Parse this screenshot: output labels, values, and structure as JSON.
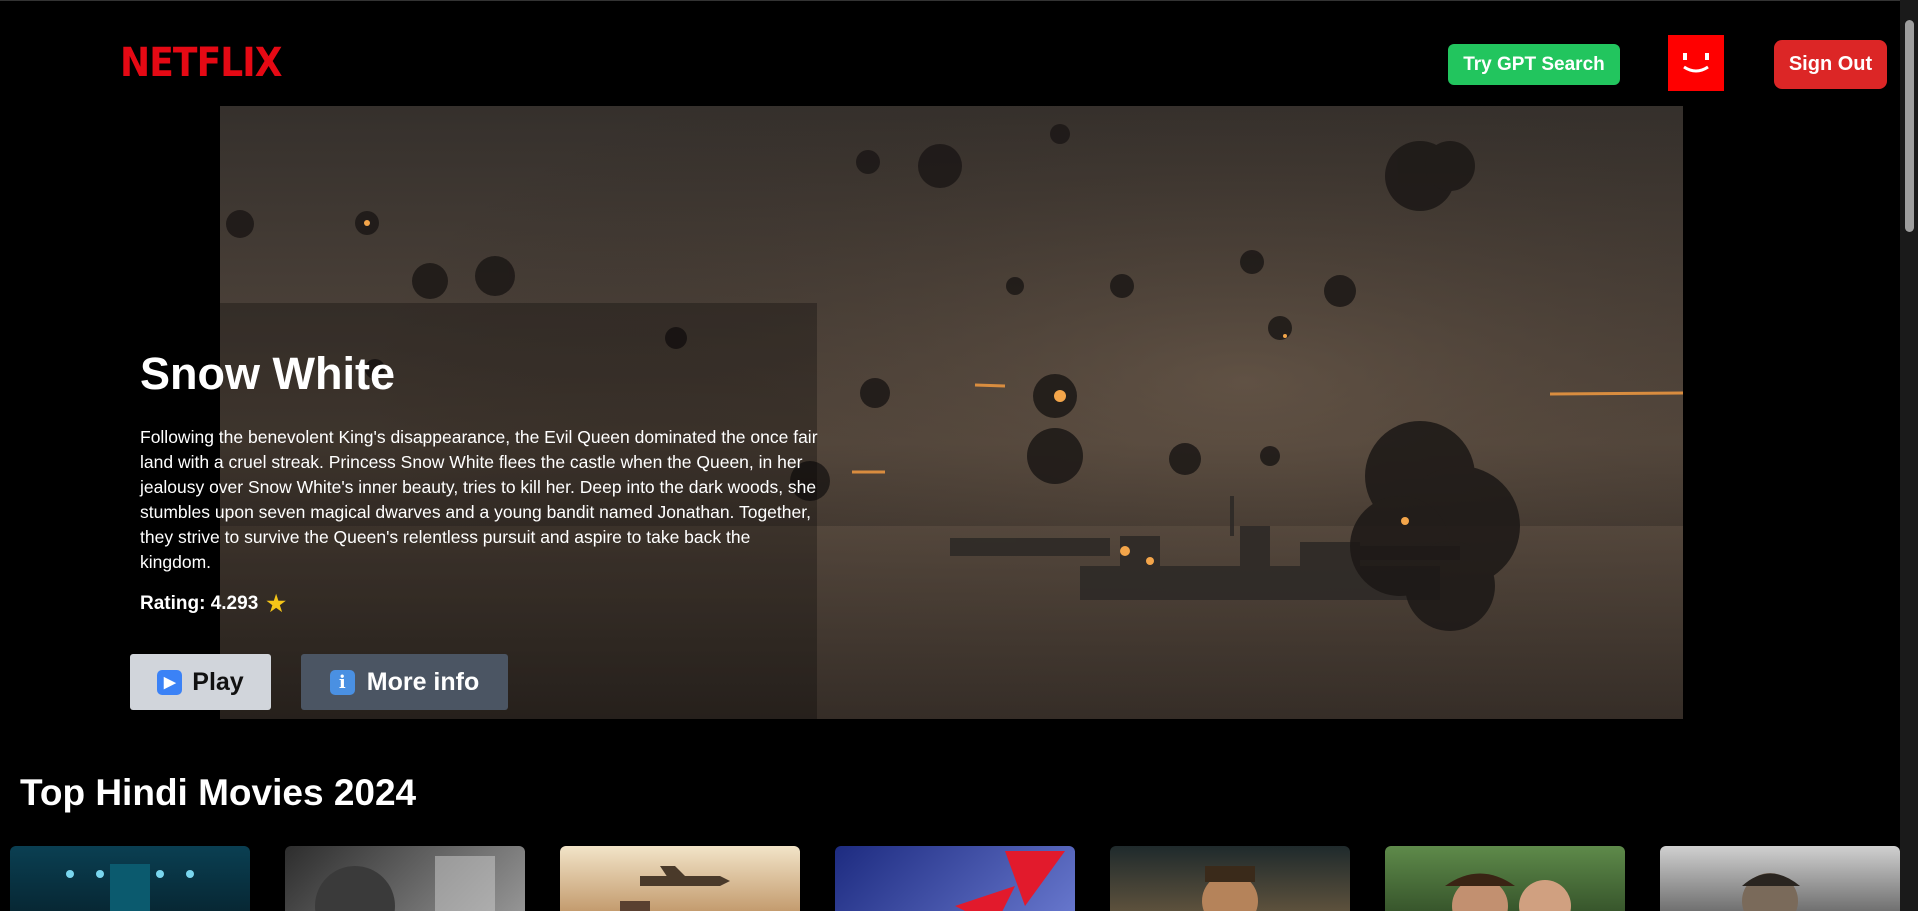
{
  "header": {
    "logo": "NETFLIX",
    "gpt_search_label": "Try GPT Search",
    "avatar_icon": "smile-avatar-icon",
    "signout_label": "Sign Out"
  },
  "hero": {
    "title": "Snow White",
    "description": "Following the benevolent King's disappearance, the Evil Queen dominated the once fair land with a cruel streak. Princess Snow White flees the castle when the Queen, in her jealousy over Snow White's inner beauty, tries to kill her. Deep into the dark woods, she stumbles upon seven magical dwarves and a young bandit named Jonathan. Together, they strive to survive the Queen's relentless pursuit and aspire to take back the kingdom.",
    "rating_label": "Rating: 4.293",
    "rating_icon": "star-icon",
    "play_icon": "play-icon",
    "play_label": "Play",
    "info_icon": "info-icon",
    "more_info_label": "More info"
  },
  "row": {
    "title": "Top Hindi Movies 2024",
    "posters": [
      {
        "name": "poster-1",
        "color": "#0e4b5c"
      },
      {
        "name": "poster-2",
        "color": "#6b6b6b"
      },
      {
        "name": "poster-3",
        "color": "#c89a6a"
      },
      {
        "name": "poster-4",
        "color": "#2a3a8a"
      },
      {
        "name": "poster-5",
        "color": "#3a4a3a"
      },
      {
        "name": "poster-6",
        "color": "#4a6a3a"
      },
      {
        "name": "poster-7",
        "color": "#8a8a8a"
      }
    ]
  },
  "colors": {
    "brand_red": "#e50914",
    "gpt_green": "#22c55e",
    "signout_red": "#dc2626"
  }
}
